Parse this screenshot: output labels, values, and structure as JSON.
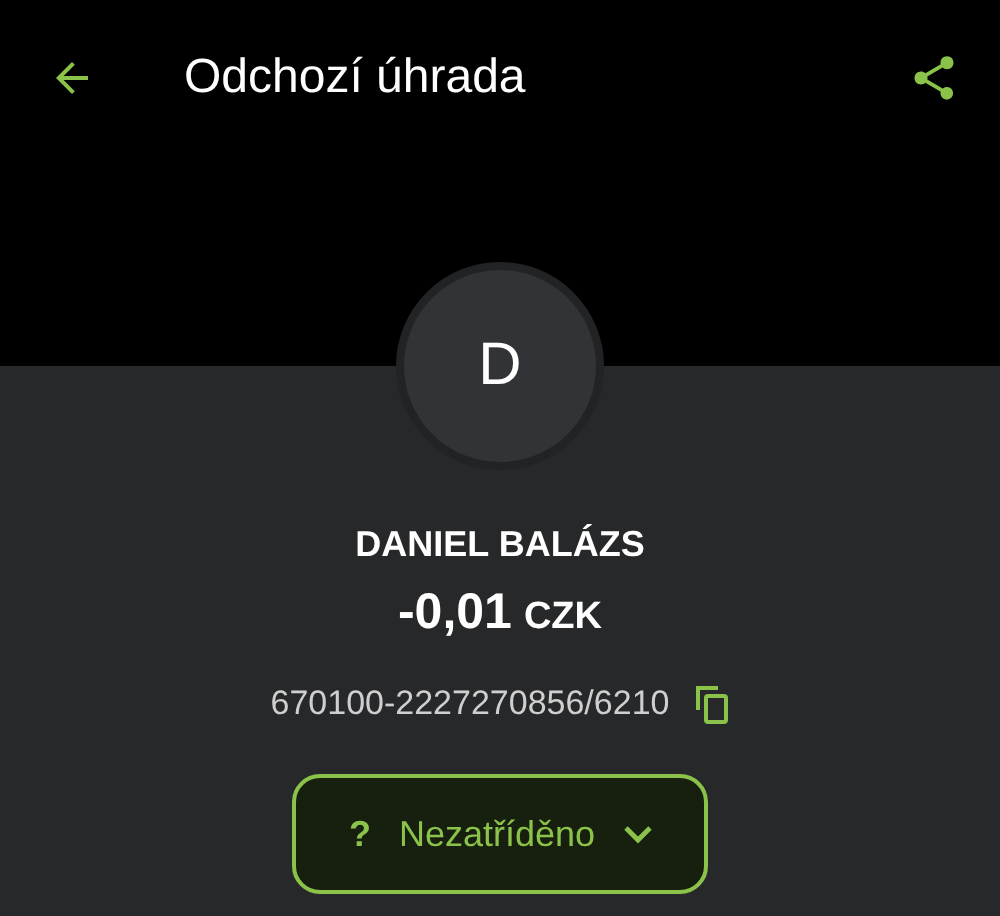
{
  "app_bar": {
    "title": "Odchozí úhrada"
  },
  "counterparty": {
    "initial": "D",
    "name": "DANIEL BALÁZS"
  },
  "amount": {
    "value": "-0,01",
    "currency": "CZK"
  },
  "account": {
    "number": "670100-2227270856/6210"
  },
  "category": {
    "icon": "?",
    "label": "Nezatříděno",
    "expanded": false
  }
}
